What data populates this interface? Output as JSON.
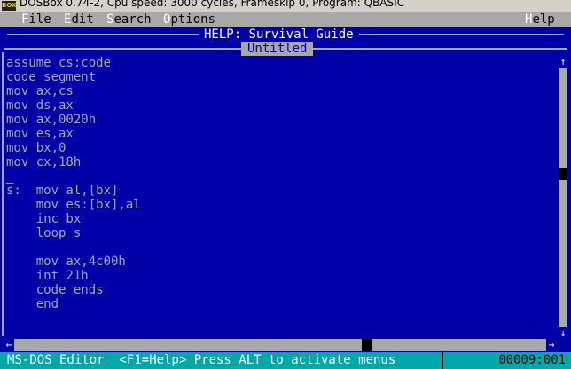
{
  "window": {
    "title": "DOSBox 0.74-2, Cpu speed:     3000 cycles, Frameskip  0, Program:   QBASIC",
    "icon_name": "dosbox-icon"
  },
  "menu": {
    "file": "File",
    "edit": "Edit",
    "search": "Search",
    "options": "Options",
    "help": "Help"
  },
  "help_window": {
    "title": "HELP: Survival Guide"
  },
  "editor": {
    "tab_title": "Untitled",
    "lines": [
      "assume cs:code",
      "code segment",
      "mov ax,cs",
      "mov ds,ax",
      "mov ax,0020h",
      "mov es,ax",
      "mov bx,0",
      "mov cx,18h",
      "",
      "s:  mov al,[bx]",
      "    mov es:[bx],al",
      "    inc bx",
      "    loop s",
      "",
      "    mov ax,4c00h",
      "    int 21h",
      "    code ends",
      "    end",
      "",
      ""
    ],
    "cursor_after_line": 8
  },
  "status": {
    "message": "MS-DOS Editor  <F1=Help> Press ALT to activate menus",
    "position": "00009:001"
  },
  "colors": {
    "editor_bg": "#0000a8",
    "text": "#a8a8a8",
    "menu_bg": "#a8a8a8",
    "status_bg": "#00a8a8"
  }
}
